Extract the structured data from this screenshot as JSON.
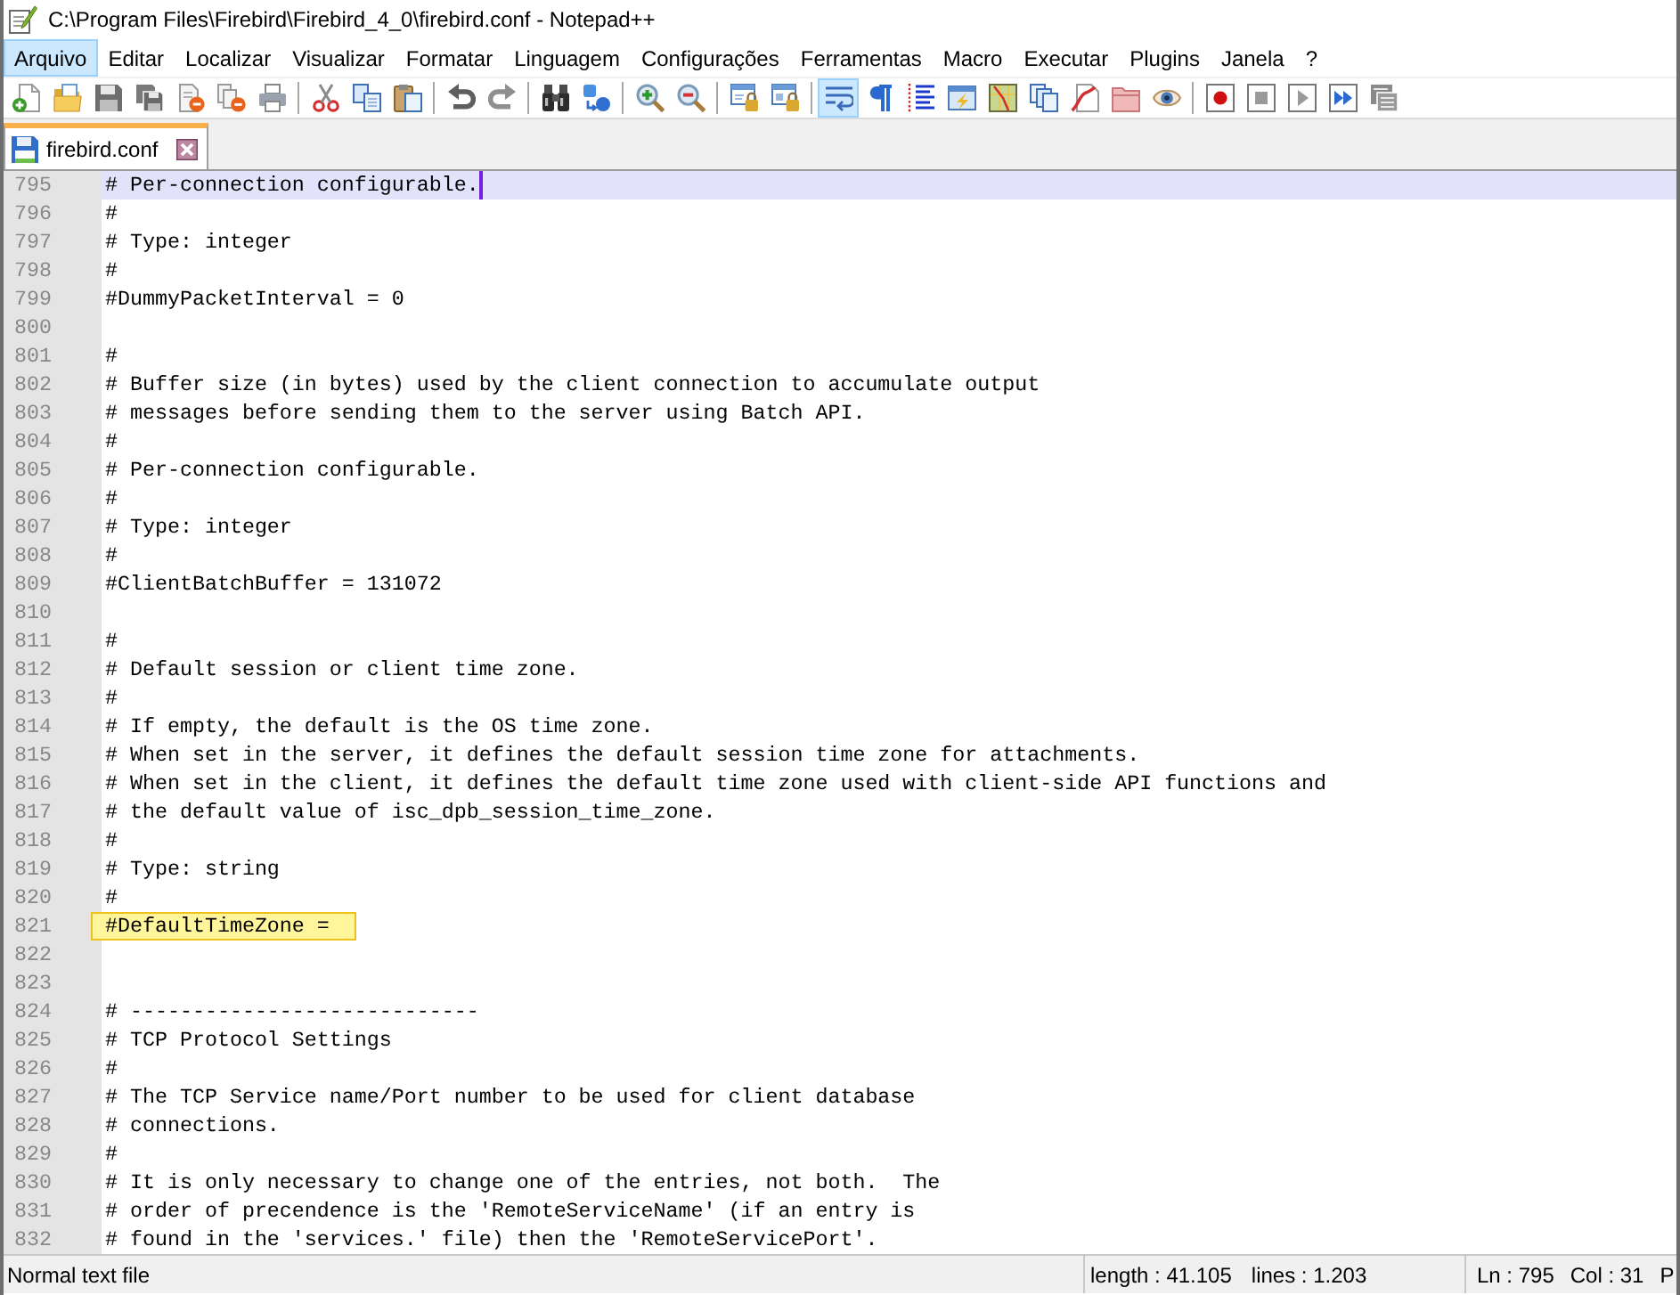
{
  "window": {
    "title": "C:\\Program Files\\Firebird\\Firebird_4_0\\firebird.conf - Notepad++"
  },
  "menu": [
    {
      "label": "Arquivo",
      "selected": true
    },
    {
      "label": "Editar",
      "selected": false
    },
    {
      "label": "Localizar",
      "selected": false
    },
    {
      "label": "Visualizar",
      "selected": false
    },
    {
      "label": "Formatar",
      "selected": false
    },
    {
      "label": "Linguagem",
      "selected": false
    },
    {
      "label": "Configurações",
      "selected": false
    },
    {
      "label": "Ferramentas",
      "selected": false
    },
    {
      "label": "Macro",
      "selected": false
    },
    {
      "label": "Executar",
      "selected": false
    },
    {
      "label": "Plugins",
      "selected": false
    },
    {
      "label": "Janela",
      "selected": false
    },
    {
      "label": "?",
      "selected": false
    }
  ],
  "toolbar": [
    {
      "kind": "button",
      "pressed": false
    },
    {
      "kind": "button",
      "pressed": false
    },
    {
      "kind": "button",
      "pressed": false
    },
    {
      "kind": "button",
      "pressed": false
    },
    {
      "kind": "button",
      "pressed": false
    },
    {
      "kind": "button",
      "pressed": false
    },
    {
      "kind": "button",
      "pressed": false
    },
    {
      "kind": "separator"
    },
    {
      "kind": "button",
      "pressed": false
    },
    {
      "kind": "button",
      "pressed": false
    },
    {
      "kind": "button",
      "pressed": false
    },
    {
      "kind": "separator"
    },
    {
      "kind": "button",
      "pressed": false
    },
    {
      "kind": "button",
      "pressed": false
    },
    {
      "kind": "separator"
    },
    {
      "kind": "button",
      "pressed": false
    },
    {
      "kind": "button",
      "pressed": false
    },
    {
      "kind": "separator"
    },
    {
      "kind": "button",
      "pressed": false
    },
    {
      "kind": "button",
      "pressed": false
    },
    {
      "kind": "separator"
    },
    {
      "kind": "button",
      "pressed": false
    },
    {
      "kind": "button",
      "pressed": false
    },
    {
      "kind": "separator"
    },
    {
      "kind": "button",
      "pressed": true
    },
    {
      "kind": "button",
      "pressed": false
    },
    {
      "kind": "button",
      "pressed": false
    },
    {
      "kind": "button",
      "pressed": false
    },
    {
      "kind": "button",
      "pressed": false
    },
    {
      "kind": "button",
      "pressed": false
    },
    {
      "kind": "button",
      "pressed": false
    },
    {
      "kind": "button",
      "pressed": false
    },
    {
      "kind": "button",
      "pressed": false
    },
    {
      "kind": "separator"
    },
    {
      "kind": "button",
      "pressed": false
    },
    {
      "kind": "button",
      "pressed": false
    },
    {
      "kind": "button",
      "pressed": false
    },
    {
      "kind": "button",
      "pressed": false
    },
    {
      "kind": "button",
      "pressed": false
    }
  ],
  "tabs": [
    {
      "label": "firebird.conf",
      "selected": true
    }
  ],
  "editor": {
    "lines": [
      {
        "number": "795",
        "text": "# Per-connection configurable.",
        "current": true,
        "marked": false
      },
      {
        "number": "796",
        "text": "#",
        "current": false,
        "marked": false
      },
      {
        "number": "797",
        "text": "# Type: integer",
        "current": false,
        "marked": false
      },
      {
        "number": "798",
        "text": "#",
        "current": false,
        "marked": false
      },
      {
        "number": "799",
        "text": "#DummyPacketInterval = 0",
        "current": false,
        "marked": false
      },
      {
        "number": "800",
        "current": false,
        "marked": false
      },
      {
        "number": "801",
        "text": "#",
        "current": false,
        "marked": false
      },
      {
        "number": "802",
        "text": "# Buffer size (in bytes) used by the client connection to accumulate output",
        "current": false,
        "marked": false
      },
      {
        "number": "803",
        "text": "# messages before sending them to the server using Batch API.",
        "current": false,
        "marked": false
      },
      {
        "number": "804",
        "text": "#",
        "current": false,
        "marked": false
      },
      {
        "number": "805",
        "text": "# Per-connection configurable.",
        "current": false,
        "marked": false
      },
      {
        "number": "806",
        "text": "#",
        "current": false,
        "marked": false
      },
      {
        "number": "807",
        "text": "# Type: integer",
        "current": false,
        "marked": false
      },
      {
        "number": "808",
        "text": "#",
        "current": false,
        "marked": false
      },
      {
        "number": "809",
        "text": "#ClientBatchBuffer = 131072",
        "current": false,
        "marked": false
      },
      {
        "number": "810",
        "current": false,
        "marked": false
      },
      {
        "number": "811",
        "text": "#",
        "current": false,
        "marked": false
      },
      {
        "number": "812",
        "text": "# Default session or client time zone.",
        "current": false,
        "marked": false
      },
      {
        "number": "813",
        "text": "#",
        "current": false,
        "marked": false
      },
      {
        "number": "814",
        "text": "# If empty, the default is the OS time zone.",
        "current": false,
        "marked": false
      },
      {
        "number": "815",
        "text": "# When set in the server, it defines the default session time zone for attachments.",
        "current": false,
        "marked": false
      },
      {
        "number": "816",
        "text": "# When set in the client, it defines the default time zone used with client-side API functions and",
        "current": false,
        "marked": false
      },
      {
        "number": "817",
        "text": "# the default value of isc_dpb_session_time_zone.",
        "current": false,
        "marked": false
      },
      {
        "number": "818",
        "text": "#",
        "current": false,
        "marked": false
      },
      {
        "number": "819",
        "text": "# Type: string",
        "current": false,
        "marked": false
      },
      {
        "number": "820",
        "text": "#",
        "current": false,
        "marked": false
      },
      {
        "number": "821",
        "text": "#DefaultTimeZone =",
        "current": false,
        "marked": true
      },
      {
        "number": "822",
        "current": false,
        "marked": false
      },
      {
        "number": "823",
        "current": false,
        "marked": false
      },
      {
        "number": "824",
        "text": "# ----------------------------",
        "current": false,
        "marked": false
      },
      {
        "number": "825",
        "text": "# TCP Protocol Settings",
        "current": false,
        "marked": false
      },
      {
        "number": "826",
        "text": "#",
        "current": false,
        "marked": false
      },
      {
        "number": "827",
        "text": "# The TCP Service name/Port number to be used for client database",
        "current": false,
        "marked": false
      },
      {
        "number": "828",
        "text": "# connections.",
        "current": false,
        "marked": false
      },
      {
        "number": "829",
        "text": "#",
        "current": false,
        "marked": false
      },
      {
        "number": "830",
        "text": "# It is only necessary to change one of the entries, not both.  The",
        "current": false,
        "marked": false
      },
      {
        "number": "831",
        "text": "# order of precendence is the 'RemoteServiceName' (if an entry is",
        "current": false,
        "marked": false
      },
      {
        "number": "832",
        "text": "# found in the 'services.' file) then the 'RemoteServicePort'.",
        "current": false,
        "marked": false
      }
    ]
  },
  "status_bar": {
    "sections": [
      {
        "items": [
          "Normal text file"
        ]
      },
      {
        "items": [
          "length : 41.105",
          "lines : 1.203"
        ]
      },
      {
        "items": [
          "Ln : 795",
          "Col : 31",
          "P"
        ]
      }
    ]
  }
}
